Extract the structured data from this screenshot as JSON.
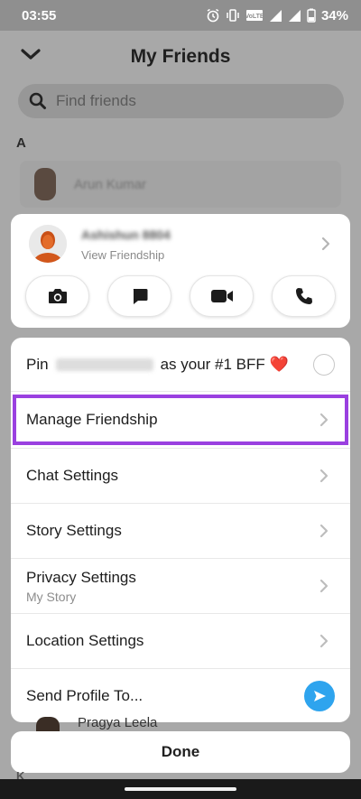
{
  "status_bar": {
    "time": "03:55",
    "battery": "34%",
    "icons": [
      "alarm-icon",
      "vibrate-icon",
      "volte-icon",
      "signal-icon",
      "signal-icon",
      "battery-icon"
    ]
  },
  "header": {
    "title": "My Friends",
    "back_icon": "chevron-down-icon"
  },
  "search": {
    "placeholder": "Find friends",
    "icon": "search-icon"
  },
  "friends_list": {
    "section_letter": "A",
    "row_name": "Arun Kumar",
    "bottom_row_name": "Pragya Leela",
    "next_section_letter": "K"
  },
  "profile_card": {
    "name": "Ashishun 8804",
    "subtitle": "View Friendship",
    "actions": [
      {
        "icon": "camera-icon"
      },
      {
        "icon": "chat-icon"
      },
      {
        "icon": "video-call-icon"
      },
      {
        "icon": "phone-icon"
      }
    ]
  },
  "menu": {
    "pin": {
      "prefix": "Pin",
      "blurred_name": "Ashishun 8804",
      "suffix": "as your #1 BFF ❤️"
    },
    "items": [
      {
        "label": "Manage Friendship",
        "sub": ""
      },
      {
        "label": "Chat Settings",
        "sub": ""
      },
      {
        "label": "Story Settings",
        "sub": ""
      },
      {
        "label": "Privacy Settings",
        "sub": "My Story"
      },
      {
        "label": "Location Settings",
        "sub": ""
      }
    ],
    "send_profile": "Send Profile To..."
  },
  "done_label": "Done",
  "colors": {
    "highlight": "#9a40e0",
    "send_button": "#2ea4ee",
    "overlay": "#a8a8a8"
  }
}
